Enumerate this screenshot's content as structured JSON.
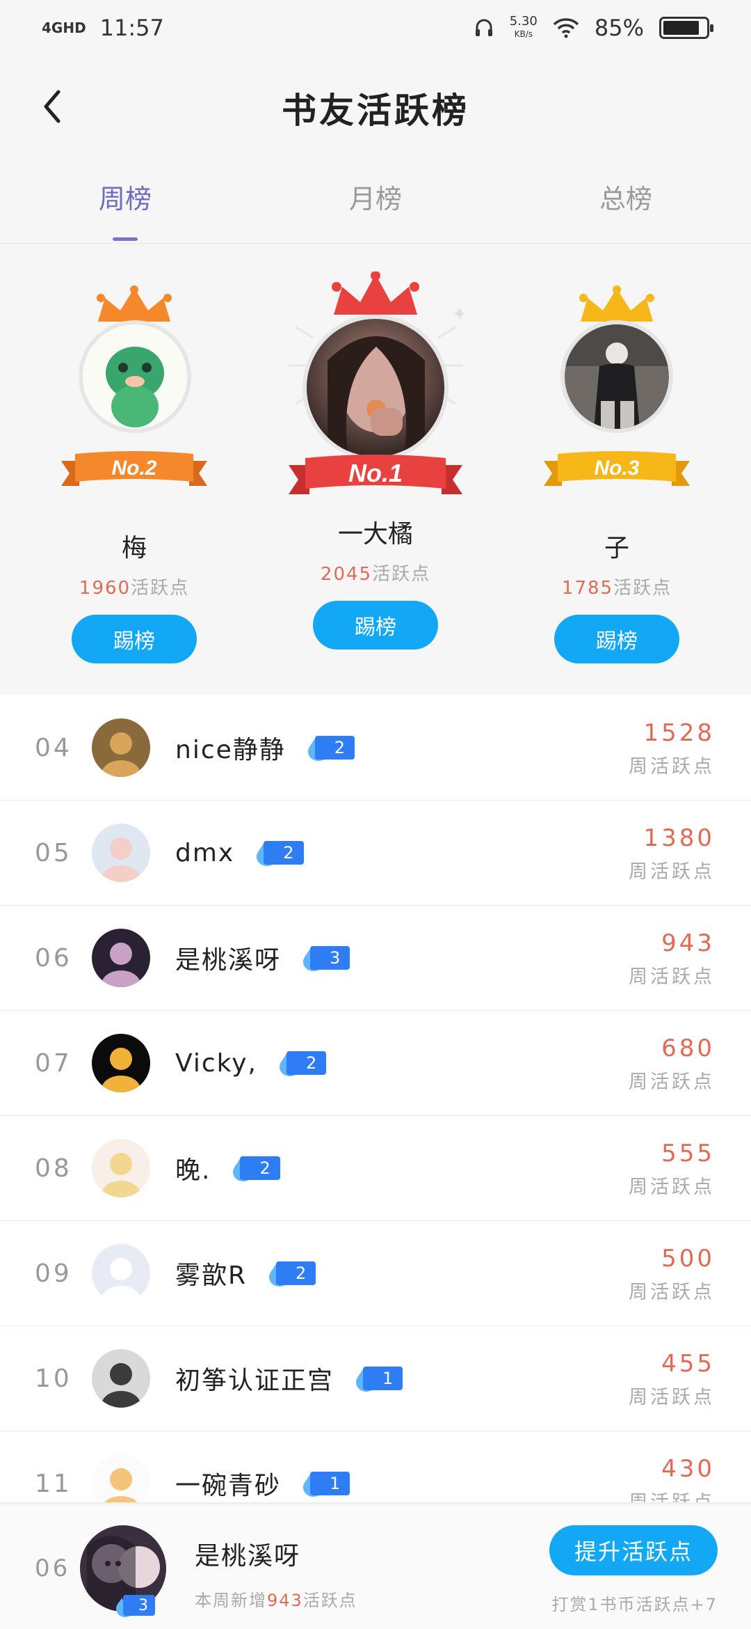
{
  "status_bar": {
    "network": "4GHD",
    "time": "11:57",
    "speed": "5.30",
    "speed_unit": "KB/s",
    "battery": "85%",
    "battery_level": 0.85
  },
  "header": {
    "title": "书友活跃榜"
  },
  "tabs": [
    {
      "label": "周榜",
      "active": true
    },
    {
      "label": "月榜",
      "active": false
    },
    {
      "label": "总榜",
      "active": false
    }
  ],
  "podium": {
    "first": {
      "badge": "No.1",
      "name": "一大橘",
      "points": "2045",
      "points_suffix": "活跃点",
      "button": "踢榜"
    },
    "second": {
      "badge": "No.2",
      "name": "梅",
      "points": "1960",
      "points_suffix": "活跃点",
      "button": "踢榜"
    },
    "third": {
      "badge": "No.3",
      "name": "子",
      "points": "1785",
      "points_suffix": "活跃点",
      "button": "踢榜"
    }
  },
  "list": [
    {
      "rank": "04",
      "name": "nice静静",
      "level": "2",
      "score": "1528",
      "unit": "周活跃点"
    },
    {
      "rank": "05",
      "name": "dmx",
      "level": "2",
      "score": "1380",
      "unit": "周活跃点"
    },
    {
      "rank": "06",
      "name": "是桃溪呀",
      "level": "3",
      "score": "943",
      "unit": "周活跃点"
    },
    {
      "rank": "07",
      "name": "Vicky,",
      "level": "2",
      "score": "680",
      "unit": "周活跃点"
    },
    {
      "rank": "08",
      "name": "晚.",
      "level": "2",
      "score": "555",
      "unit": "周活跃点"
    },
    {
      "rank": "09",
      "name": "雾歆R",
      "level": "2",
      "score": "500",
      "unit": "周活跃点"
    },
    {
      "rank": "10",
      "name": "初筝认证正宫",
      "level": "1",
      "score": "455",
      "unit": "周活跃点"
    },
    {
      "rank": "11",
      "name": "一碗青砂",
      "level": "1",
      "score": "430",
      "unit": "周活跃点"
    }
  ],
  "my_bar": {
    "rank": "06",
    "name": "是桃溪呀",
    "level": "3",
    "weekly_prefix": "本周新增",
    "weekly_points": "943",
    "weekly_suffix": "活跃点",
    "boost_button": "提升活跃点",
    "tip_prefix": "打赏",
    "tip_num": "1",
    "tip_suffix": "书币活跃点+7"
  },
  "colors": {
    "accent": "#12a8f5",
    "tab_active": "#6f6bbf",
    "score": "#e06a55",
    "level_badge": "#2f7df5",
    "crown_first": "#e8413f",
    "crown_second": "#f5882a",
    "crown_third": "#f7b718"
  }
}
